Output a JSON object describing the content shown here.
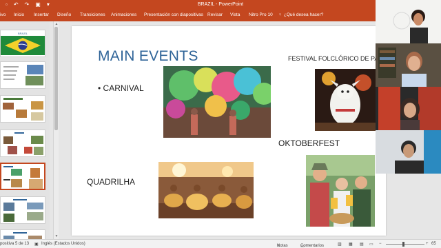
{
  "window": {
    "title": "BRAZIL - PowerPoint"
  },
  "ribbon": {
    "tabs": [
      "ivo",
      "Inicio",
      "Insertar",
      "Diseño",
      "Transiciones",
      "Animaciones",
      "Presentación con diapositivas",
      "Revisar",
      "Vista",
      "Nitro Pro 10"
    ],
    "tell_me": "¿Qué desea hacer?"
  },
  "slide": {
    "title": "MAIN EVENTS",
    "bullet": "• CARNIVAL",
    "festival_label": "FESTIVAL FOLCLÓRICO DE PARE",
    "oktoberfest_label": "OKTOBERFEST",
    "quadrilha_label": "QUADRILHA"
  },
  "thumbnails": {
    "first_title": "BRAZIL",
    "active_index": 5
  },
  "status": {
    "slide_info": "positiva 5 de 13",
    "language": "Inglés (Estados Unidos)",
    "notes": "Notas",
    "comments": "Comentarios",
    "zoom": "65"
  },
  "colors": {
    "accent": "#c4471f",
    "title_blue": "#2f6498"
  },
  "icons": [
    "undo-icon",
    "redo-icon",
    "present-icon",
    "customize-icon",
    "lightbulb-icon",
    "notes-icon",
    "comments-icon",
    "normal-view-icon",
    "sorter-view-icon",
    "reading-view-icon",
    "slideshow-icon",
    "fit-icon"
  ]
}
